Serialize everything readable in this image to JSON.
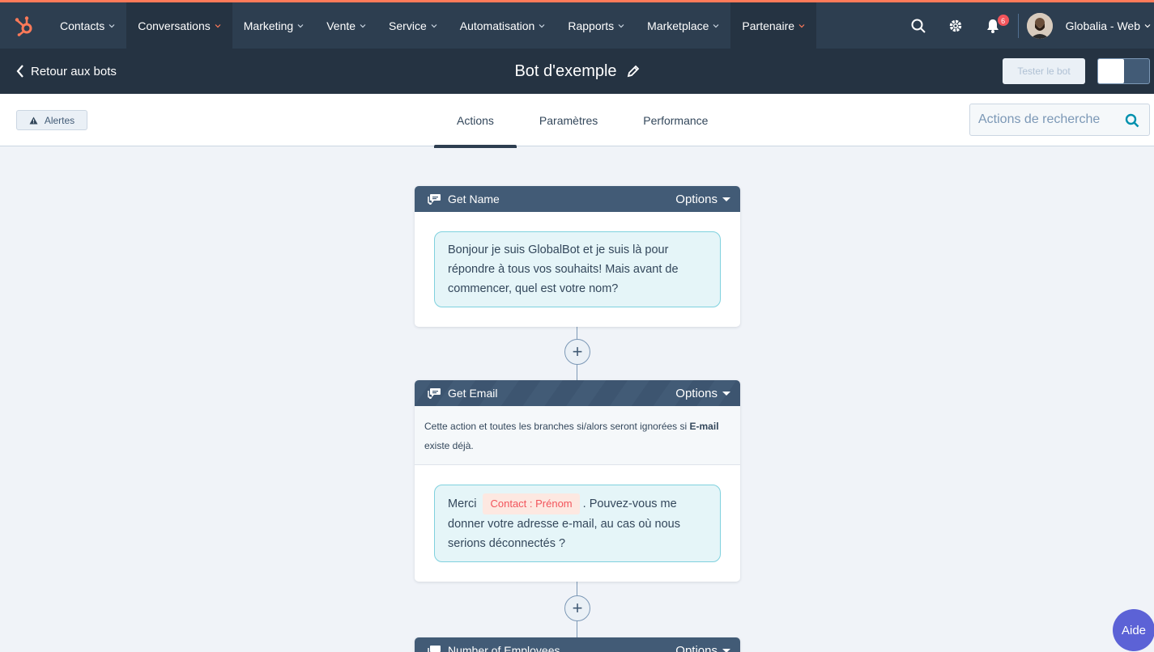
{
  "nav": {
    "items": [
      {
        "label": "Contacts",
        "active": false
      },
      {
        "label": "Conversations",
        "active": true
      },
      {
        "label": "Marketing",
        "active": false
      },
      {
        "label": "Vente",
        "active": false
      },
      {
        "label": "Service",
        "active": false
      },
      {
        "label": "Automatisation",
        "active": false
      },
      {
        "label": "Rapports",
        "active": false
      },
      {
        "label": "Marketplace",
        "active": false
      },
      {
        "label": "Partenaire",
        "active": true
      }
    ],
    "notifications_count": "6",
    "account_name": "Globalia - Web"
  },
  "subbar": {
    "back_label": "Retour aux bots",
    "bot_title": "Bot d'exemple",
    "test_button": "Tester le bot"
  },
  "tabsbar": {
    "alerts_label": "Alertes",
    "tabs": [
      {
        "label": "Actions",
        "active": true
      },
      {
        "label": "Paramètres",
        "active": false
      },
      {
        "label": "Performance",
        "active": false
      }
    ],
    "search_placeholder": "Actions de recherche"
  },
  "cards": {
    "get_name": {
      "title": "Get Name",
      "options_label": "Options",
      "message": "Bonjour je suis GlobalBot et je suis là pour répondre à tous vos souhaits! Mais avant de commencer, quel est votre nom?"
    },
    "get_email": {
      "title": "Get Email",
      "options_label": "Options",
      "note_prefix": "Cette action et toutes les branches si/alors seront ignorées si ",
      "note_field": "E-mail",
      "note_suffix": " existe déjà.",
      "message_prefix": "Merci ",
      "token": "Contact : Prénom",
      "message_suffix": ". Pouvez-vous me donner votre adresse e-mail, au cas où nous serions déconnectés ?"
    },
    "number_of_employees": {
      "title": "Number of Employees",
      "options_label": "Options"
    }
  },
  "help_label": "Aide",
  "colors": {
    "nav_bg": "#2d3e50",
    "accent": "#ff7a59",
    "bubble_bg": "#e5f5f8",
    "token_text": "#f2545b",
    "help_bg": "#5c62d6"
  }
}
